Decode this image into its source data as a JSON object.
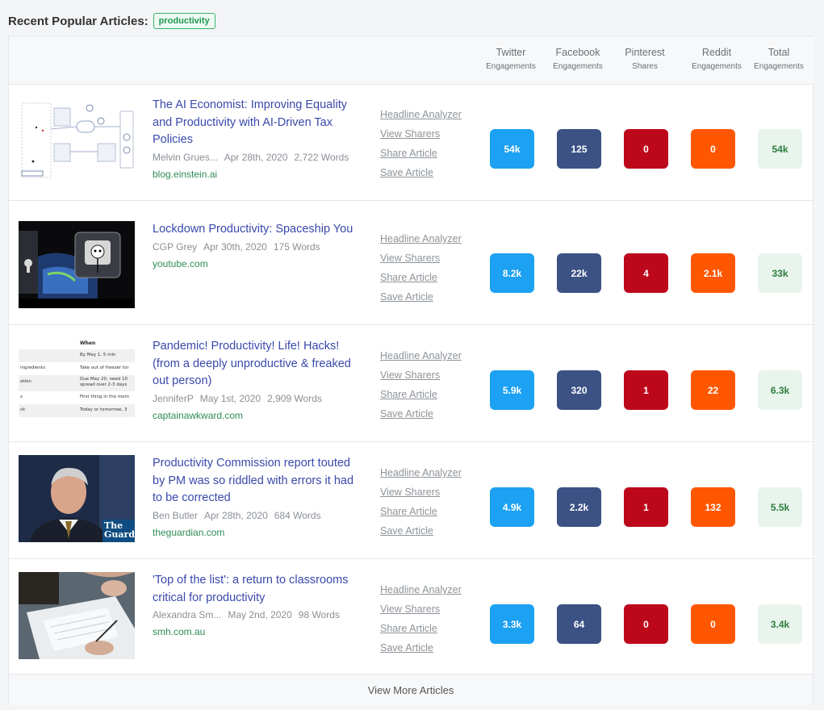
{
  "header": {
    "title": "Recent Popular Articles:",
    "topic": "productivity"
  },
  "columns": [
    {
      "line1": "Twitter",
      "line2": "Engagements"
    },
    {
      "line1": "Facebook",
      "line2": "Engagements"
    },
    {
      "line1": "Pinterest",
      "line2": "Shares"
    },
    {
      "line1": "Reddit",
      "line2": "Engagements"
    },
    {
      "line1": "Total",
      "line2": "Engagements"
    }
  ],
  "actions": [
    "Headline Analyzer",
    "View Sharers",
    "Share Article",
    "Save Article"
  ],
  "articles": [
    {
      "title": "The AI Economist: Improving Equality and Productivity with AI-Driven Tax Policies",
      "author": "Melvin Grues...",
      "date": "Apr 28th, 2020",
      "words": "2,722 Words",
      "domain": "blog.einstein.ai",
      "twitter": "54k",
      "facebook": "125",
      "pinterest": "0",
      "reddit": "0",
      "total": "54k"
    },
    {
      "title": "Lockdown Productivity: Spaceship You",
      "author": "CGP Grey",
      "date": "Apr 30th, 2020",
      "words": "175 Words",
      "domain": "youtube.com",
      "twitter": "8.2k",
      "facebook": "22k",
      "pinterest": "4",
      "reddit": "2.1k",
      "total": "33k"
    },
    {
      "title": "Pandemic! Productivity! Life! Hacks! (from a deeply unproductive & freaked out person)",
      "author": "JenniferP",
      "date": "May 1st, 2020",
      "words": "2,909 Words",
      "domain": "captainawkward.com",
      "twitter": "5.9k",
      "facebook": "320",
      "pinterest": "1",
      "reddit": "22",
      "total": "6.3k"
    },
    {
      "title": "Productivity Commission report touted by PM was so riddled with errors it had to be corrected",
      "author": "Ben Butler",
      "date": "Apr 28th, 2020",
      "words": "684 Words",
      "domain": "theguardian.com",
      "twitter": "4.9k",
      "facebook": "2.2k",
      "pinterest": "1",
      "reddit": "132",
      "total": "5.5k"
    },
    {
      "title": "'Top of the list': a return to classrooms critical for productivity",
      "author": "Alexandra Sm...",
      "date": "May 2nd, 2020",
      "words": "98 Words",
      "domain": "smh.com.au",
      "twitter": "3.3k",
      "facebook": "64",
      "pinterest": "0",
      "reddit": "0",
      "total": "3.4k"
    }
  ],
  "thumb3": {
    "header": "When",
    "rows": [
      {
        "left": "",
        "right": "By May 1, 5 min"
      },
      {
        "left": "ingredients",
        "right": "Take out of freezer tor"
      },
      {
        "left": "ation",
        "right": "Due May 20, need 10 spread over 2-3 days"
      },
      {
        "left": "s",
        "right": "First thing in the morn"
      },
      {
        "left": "ck",
        "right": "Today or tomorrow, 3"
      }
    ]
  },
  "thumb4": {
    "watermark": "The Guard"
  },
  "footer": {
    "label": "View More Articles"
  }
}
